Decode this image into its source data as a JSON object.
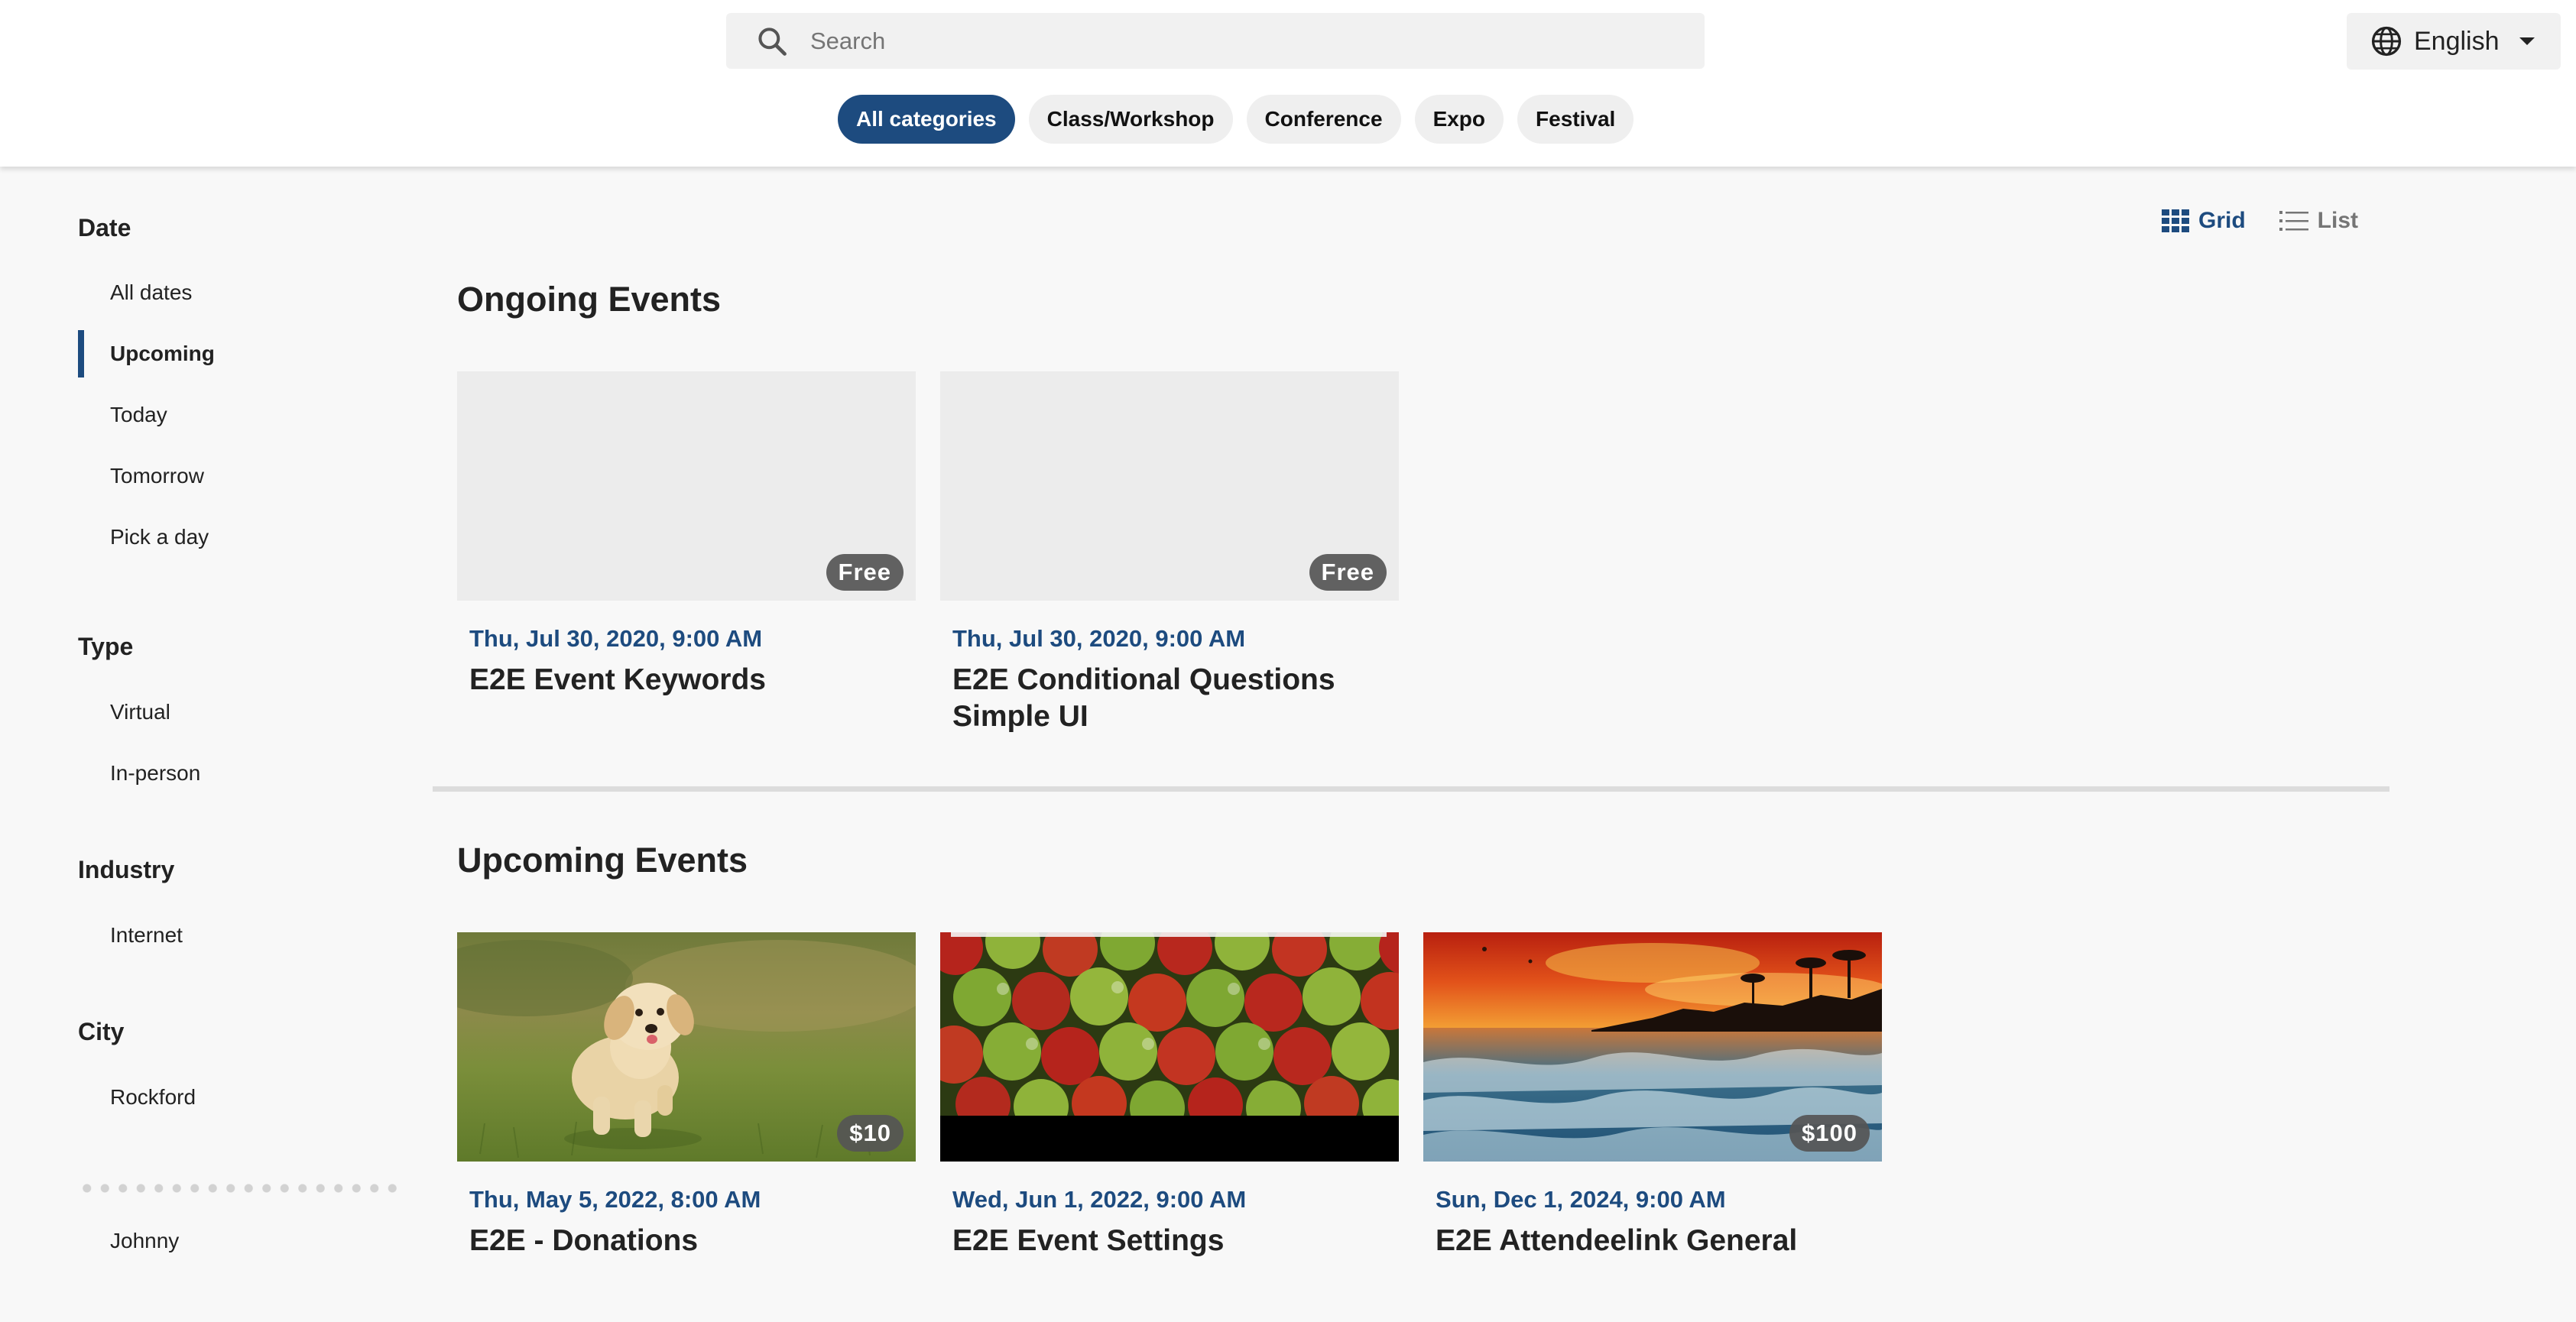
{
  "header": {
    "search_placeholder": "Search",
    "language": "English",
    "categories": [
      "All categories",
      "Class/Workshop",
      "Conference",
      "Expo",
      "Festival"
    ],
    "active_category": "All categories"
  },
  "sidebar": {
    "date": {
      "title": "Date",
      "items": [
        "All dates",
        "Upcoming",
        "Today",
        "Tomorrow",
        "Pick a day"
      ],
      "selected": "Upcoming"
    },
    "type": {
      "title": "Type",
      "items": [
        "Virtual",
        "In-person"
      ]
    },
    "industry": {
      "title": "Industry",
      "items": [
        "Internet"
      ]
    },
    "city": {
      "title": "City",
      "items": [
        "Rockford"
      ]
    },
    "organizer": {
      "items": [
        "Johnny"
      ]
    }
  },
  "view_toggle": {
    "grid": "Grid",
    "list": "List",
    "active": "Grid"
  },
  "ongoing": {
    "title": "Ongoing Events",
    "events": [
      {
        "date": "Thu, Jul 30, 2020, 9:00 AM",
        "title": "E2E Event Keywords",
        "price": "Free",
        "image": "placeholder"
      },
      {
        "date": "Thu, Jul 30, 2020, 9:00 AM",
        "title": "E2E Conditional Questions Simple UI",
        "price": "Free",
        "image": "placeholder"
      }
    ]
  },
  "upcoming": {
    "title": "Upcoming Events",
    "events": [
      {
        "date": "Thu, May 5, 2022, 8:00 AM",
        "title": "E2E - Donations",
        "price": "$10",
        "image": "puppy"
      },
      {
        "date": "Wed, Jun 1, 2022, 9:00 AM",
        "title": "E2E Event Settings",
        "price": "",
        "image": "apples"
      },
      {
        "date": "Sun, Dec 1, 2024, 9:00 AM",
        "title": "E2E Attendeelink General",
        "price": "$100",
        "image": "sunset-beach"
      }
    ]
  },
  "colors": {
    "accent": "#1d4b7f",
    "badge": "#555555",
    "background": "#f8f8f8"
  }
}
